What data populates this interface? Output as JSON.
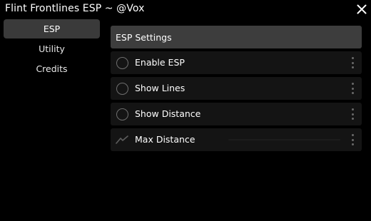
{
  "window": {
    "title": "Flint Frontlines ESP ~ @Vox"
  },
  "sidebar": {
    "items": [
      {
        "label": "ESP",
        "active": true
      },
      {
        "label": "Utility",
        "active": false
      },
      {
        "label": "Credits",
        "active": false
      }
    ]
  },
  "content": {
    "section_title": "ESP Settings",
    "rows": [
      {
        "label": "Enable ESP",
        "icon": "toggle-circle-icon"
      },
      {
        "label": "Show Lines",
        "icon": "toggle-circle-icon"
      },
      {
        "label": "Show Distance",
        "icon": "toggle-circle-icon"
      },
      {
        "label": "Max Distance",
        "icon": "slider-trend-icon"
      }
    ]
  },
  "colors": {
    "background": "#000000",
    "active_tab": "#3a3a3a",
    "section_header": "#3d3d3d",
    "row_background": "#141414",
    "muted_icon": "#6e6e6e"
  }
}
